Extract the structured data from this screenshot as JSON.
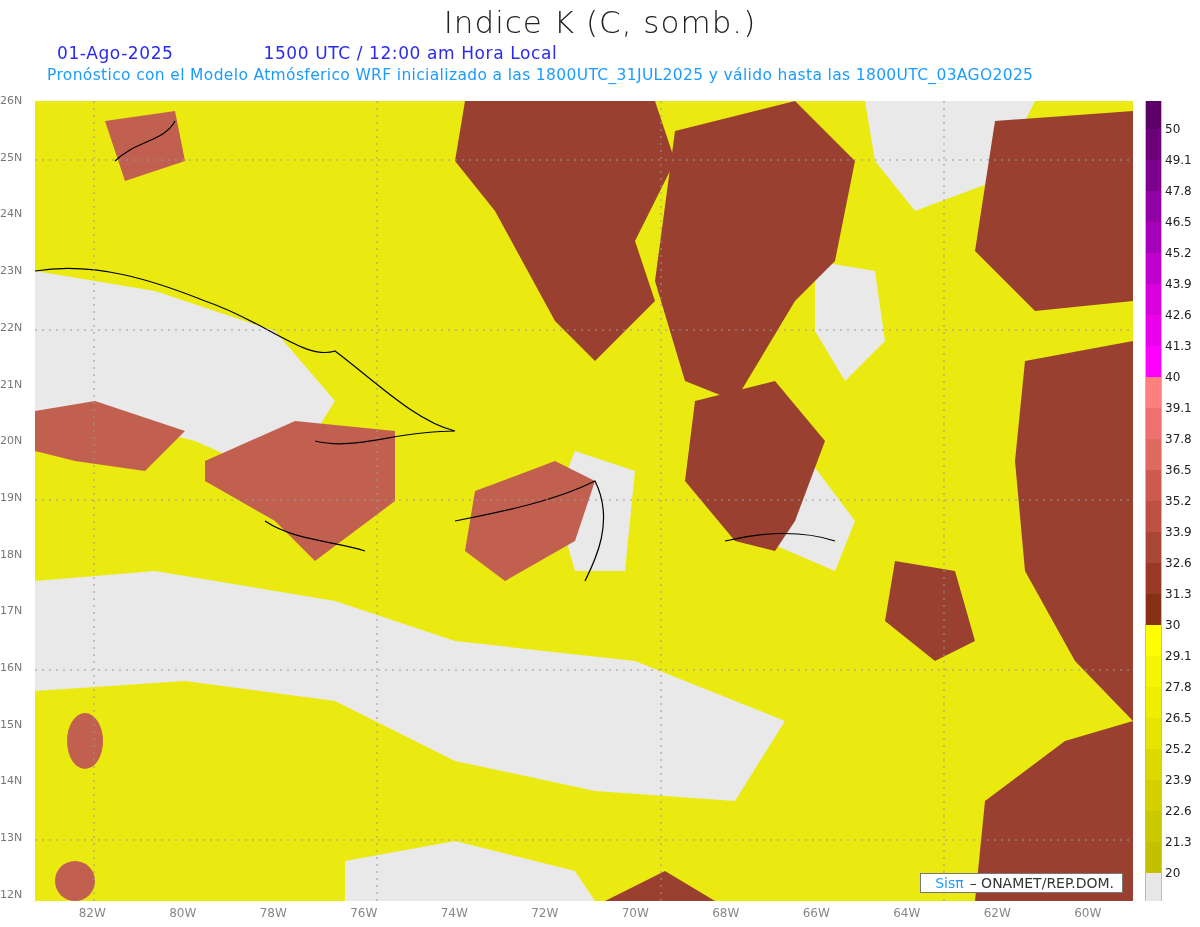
{
  "title": "Indice K (C, somb.)",
  "date": "01-Ago-2025",
  "time": "1500 UTC / 12:00 am Hora Local",
  "subtitle": "Pronóstico con el Modelo Atmósferico WRF inicializado a las 1800UTC_31JUL2025 y válido hasta las  1800UTC_03AGO2025",
  "lat_labels": [
    "26N",
    "25N",
    "24N",
    "23N",
    "22N",
    "21N",
    "20N",
    "19N",
    "18N",
    "17N",
    "16N",
    "15N",
    "14N",
    "13N",
    "12N"
  ],
  "lon_labels": [
    "82W",
    "80W",
    "78W",
    "76W",
    "74W",
    "72W",
    "70W",
    "68W",
    "66W",
    "64W",
    "62W",
    "60W"
  ],
  "colorbar": [
    {
      "color": "#5c0068"
    },
    {
      "label": "50",
      "color": "#6c0078"
    },
    {
      "label": "49.1",
      "color": "#7c008c"
    },
    {
      "label": "47.8",
      "color": "#9200a6"
    },
    {
      "label": "46.5",
      "color": "#a600ba"
    },
    {
      "label": "45.2",
      "color": "#c000cc"
    },
    {
      "label": "43.9",
      "color": "#d800dc"
    },
    {
      "label": "42.6",
      "color": "#ea00ea"
    },
    {
      "label": "41.3",
      "color": "#ff00ff"
    },
    {
      "label": "40",
      "color": "#ff8080"
    },
    {
      "label": "39.1",
      "color": "#ee7070"
    },
    {
      "label": "37.8",
      "color": "#e06a60"
    },
    {
      "label": "36.5",
      "color": "#cc5a50"
    },
    {
      "label": "35.2",
      "color": "#bc5044"
    },
    {
      "label": "33.9",
      "color": "#aa4636"
    },
    {
      "label": "32.6",
      "color": "#983a26"
    },
    {
      "label": "31.3",
      "color": "#863016"
    },
    {
      "label": "30",
      "color": "#ffff00"
    },
    {
      "label": "29.1",
      "color": "#f6f600"
    },
    {
      "label": "27.8",
      "color": "#eeee00"
    },
    {
      "label": "26.5",
      "color": "#e6e400"
    },
    {
      "label": "25.2",
      "color": "#dcd800"
    },
    {
      "label": "23.9",
      "color": "#d4d000"
    },
    {
      "label": "22.6",
      "color": "#ccc800"
    },
    {
      "label": "21.3",
      "color": "#c4c000"
    },
    {
      "label": "20",
      "color": "#e8e8e8"
    }
  ],
  "credit": {
    "logo": "Sisπ",
    "text": "– ONAMET/REP.DOM."
  }
}
